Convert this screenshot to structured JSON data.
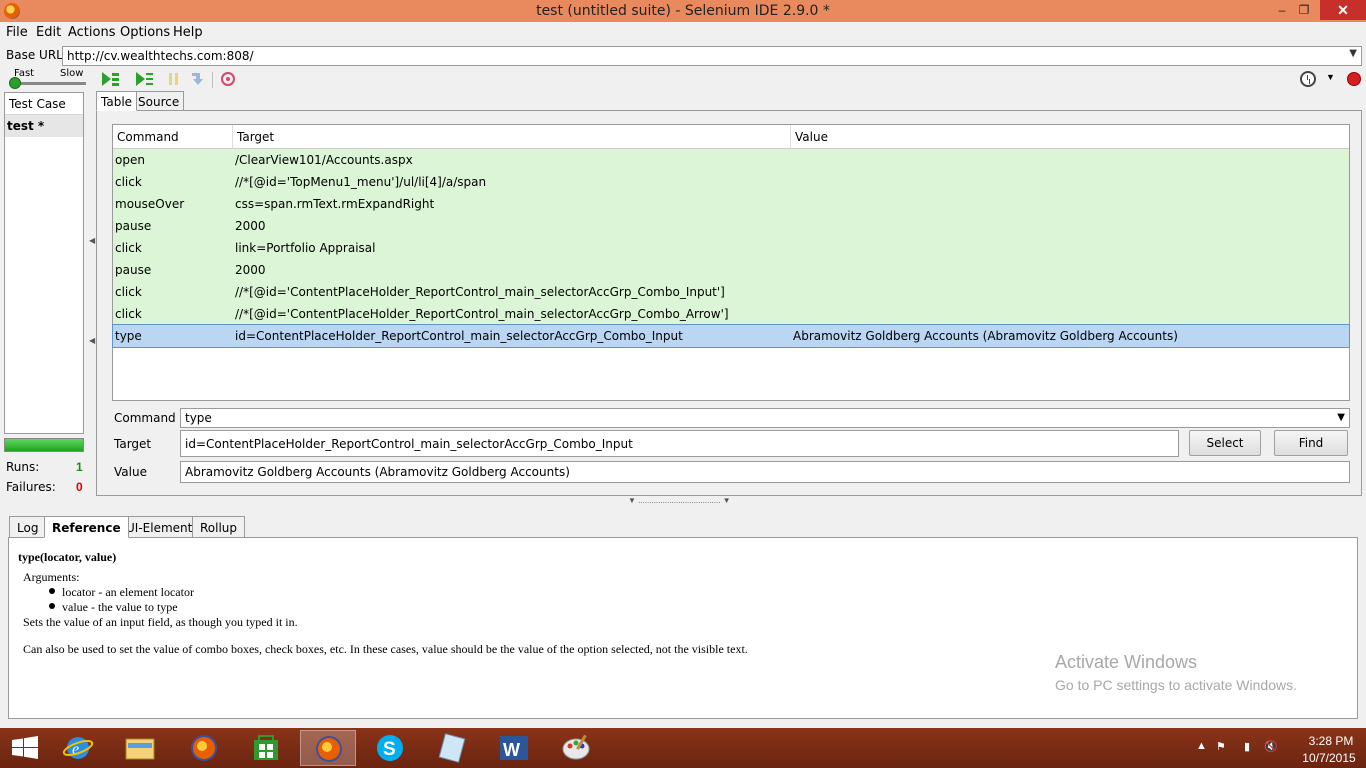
{
  "window": {
    "title": "test (untitled suite) - Selenium IDE 2.9.0 *",
    "minimize": "–",
    "maximize": "❐",
    "close": "✕"
  },
  "menu": [
    "File",
    "Edit",
    "Actions",
    "Options",
    "Help"
  ],
  "base_url": {
    "label": "Base URL",
    "value": "http://cv.wealthtechs.com:808/"
  },
  "speed": {
    "fast": "Fast",
    "slow": "Slow"
  },
  "left_panel": {
    "header": "Test Case",
    "items": [
      "test *"
    ],
    "runs_label": "Runs:",
    "runs_value": "1",
    "failures_label": "Failures:",
    "failures_value": "0"
  },
  "tabs": [
    "Table",
    "Source"
  ],
  "table": {
    "headers": [
      "Command",
      "Target",
      "Value"
    ],
    "rows": [
      {
        "command": "open",
        "target": "/ClearView101/Accounts.aspx",
        "value": ""
      },
      {
        "command": "click",
        "target": "//*[@id='TopMenu1_menu']/ul/li[4]/a/span",
        "value": ""
      },
      {
        "command": "mouseOver",
        "target": "css=span.rmText.rmExpandRight",
        "value": ""
      },
      {
        "command": "pause",
        "target": "2000",
        "value": ""
      },
      {
        "command": "click",
        "target": "link=Portfolio Appraisal",
        "value": ""
      },
      {
        "command": "pause",
        "target": "2000",
        "value": ""
      },
      {
        "command": "click",
        "target": "//*[@id='ContentPlaceHolder_ReportControl_main_selectorAccGrp_Combo_Input']",
        "value": ""
      },
      {
        "command": "click",
        "target": "//*[@id='ContentPlaceHolder_ReportControl_main_selectorAccGrp_Combo_Arrow']",
        "value": ""
      },
      {
        "command": "type",
        "target": "id=ContentPlaceHolder_ReportControl_main_selectorAccGrp_Combo_Input",
        "value": "Abramovitz Goldberg Accounts (Abramovitz Goldberg Accounts)"
      }
    ],
    "selected_row": 8
  },
  "editor": {
    "command_label": "Command",
    "command_value": "type",
    "target_label": "Target",
    "target_value": "id=ContentPlaceHolder_ReportControl_main_selectorAccGrp_Combo_Input",
    "value_label": "Value",
    "value_value": "Abramovitz Goldberg Accounts (Abramovitz Goldberg Accounts)",
    "select_button": "Select",
    "find_button": "Find"
  },
  "bottom_tabs": [
    "Log",
    "Reference",
    "UI-Element",
    "Rollup"
  ],
  "reference": {
    "signature": "type(locator, value)",
    "arguments_label": "Arguments:",
    "arguments": [
      "locator - an element locator",
      "value - the value to type"
    ],
    "desc1": "Sets the value of an input field, as though you typed it in.",
    "desc2": "Can also be used to set the value of combo boxes, check boxes, etc. In these cases, value should be the value of the option selected, not the visible text."
  },
  "watermark": {
    "line1": "Activate Windows",
    "line2": "Go to PC settings to activate Windows."
  },
  "taskbar": {
    "apps": [
      "start-icon",
      "internet-explorer-icon",
      "file-explorer-icon",
      "firefox-icon",
      "store-icon",
      "firefox-icon",
      "skype-icon",
      "notes-icon",
      "word-icon",
      "paint-icon"
    ],
    "time": "3:28 PM",
    "date": "10/7/2015"
  },
  "colors": {
    "title_bar": "#e98a5e",
    "row_bg": "#dcf5d6",
    "selected_row": "#bad6f2",
    "taskbar": "#7a2a12"
  }
}
